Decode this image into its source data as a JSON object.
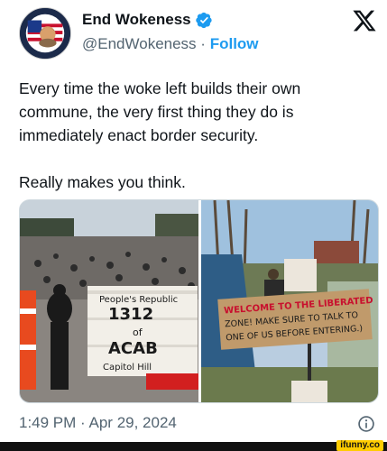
{
  "author": {
    "display_name": "End Wokeness",
    "handle": "@EndWokeness",
    "follow_label": "Follow",
    "verified": true
  },
  "avatar_badge": {
    "top_text": "I SUPPORT THE",
    "bottom_text": "FORMER THING"
  },
  "tweet": {
    "text": "Every time the woke left builds their own commune, the very first thing they do is immediately enact border security.",
    "text2": "Really makes you think."
  },
  "media": {
    "left_sign": {
      "line1": "People's Republic",
      "line2": "1312",
      "line3": "of",
      "line4": "ACAB",
      "line5": "Capitol Hill"
    },
    "right_sign": {
      "line1": "WELCOME TO THE LIBERATED",
      "line2": "ZONE! MAKE SURE TO TALK TO",
      "line3": "ONE OF US BEFORE ENTERING.)"
    }
  },
  "meta": {
    "time": "1:49 PM",
    "separator": "·",
    "date": "Apr 29, 2024"
  },
  "watermark": "ifunny.co",
  "colors": {
    "accent": "#1d9bf0",
    "secondary_text": "#536471",
    "primary_text": "#0f1419",
    "sign_red": "#c8102e"
  },
  "icons": [
    "verified-badge-icon",
    "x-logo-icon",
    "info-icon"
  ]
}
